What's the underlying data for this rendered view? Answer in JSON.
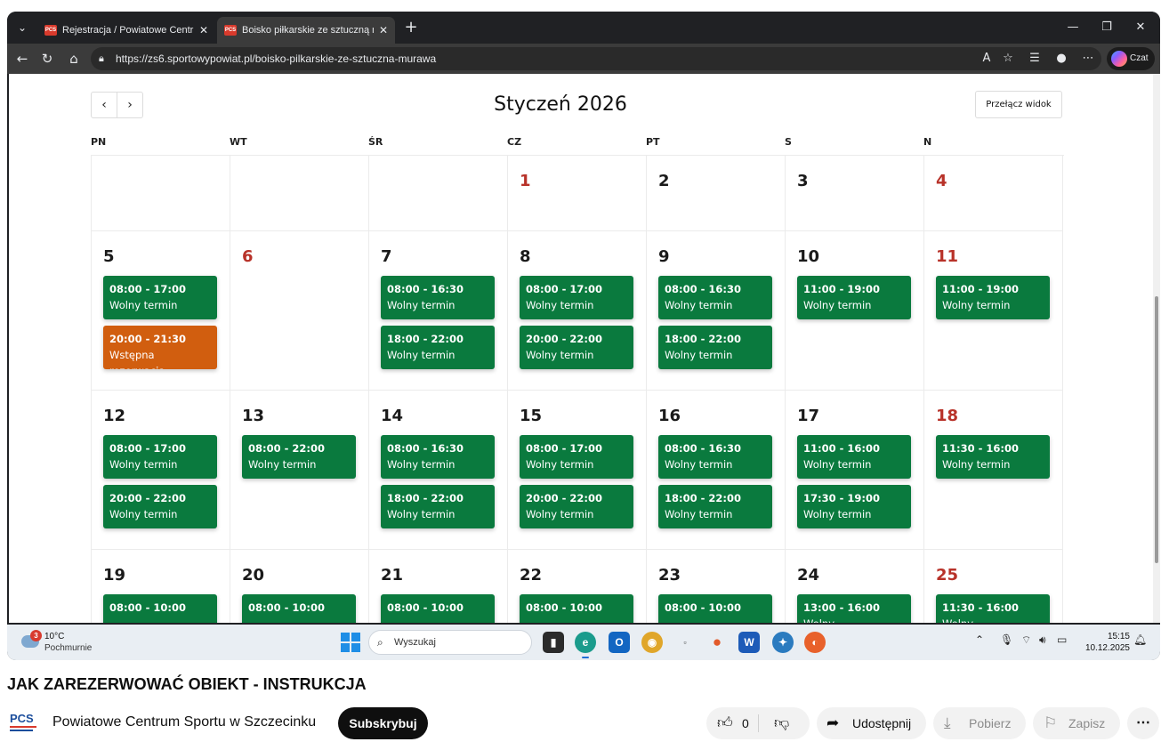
{
  "browser": {
    "tabs": [
      {
        "favicon": "PCS",
        "title": "Rejestracja / Powiatowe Centrum S"
      },
      {
        "favicon": "PCS",
        "title": "Boisko piłkarskie ze sztuczną mura"
      }
    ],
    "url": "https://zs6.sportowypowiat.pl/boisko-pilkarskie-ze-sztuczna-murawa",
    "copilot_label": "Czat"
  },
  "calendar": {
    "title": "Styczeń 2026",
    "prev_label": "‹",
    "next_label": "›",
    "view_toggle_label": "Przełącz widok",
    "weekdays": [
      "PN",
      "WT",
      "ŚR",
      "CZ",
      "PT",
      "S",
      "N"
    ],
    "weeks": [
      [
        {
          "day": "",
          "events": []
        },
        {
          "day": "",
          "events": []
        },
        {
          "day": "",
          "events": []
        },
        {
          "day": "1",
          "sunday": true,
          "events": []
        },
        {
          "day": "2",
          "events": []
        },
        {
          "day": "3",
          "events": []
        },
        {
          "day": "4",
          "sunday": true,
          "events": []
        }
      ],
      [
        {
          "day": "5",
          "events": [
            {
              "time": "08:00 - 17:00",
              "label": "Wolny termin"
            },
            {
              "time": "20:00 - 21:30",
              "label": "Wstępna rezerwacja",
              "status": "pending"
            }
          ]
        },
        {
          "day": "6",
          "sunday": true,
          "events": []
        },
        {
          "day": "7",
          "events": [
            {
              "time": "08:00 - 16:30",
              "label": "Wolny termin"
            },
            {
              "time": "18:00 - 22:00",
              "label": "Wolny termin"
            }
          ]
        },
        {
          "day": "8",
          "events": [
            {
              "time": "08:00 - 17:00",
              "label": "Wolny termin"
            },
            {
              "time": "20:00 - 22:00",
              "label": "Wolny termin"
            }
          ]
        },
        {
          "day": "9",
          "events": [
            {
              "time": "08:00 - 16:30",
              "label": "Wolny termin"
            },
            {
              "time": "18:00 - 22:00",
              "label": "Wolny termin"
            }
          ]
        },
        {
          "day": "10",
          "events": [
            {
              "time": "11:00 - 19:00",
              "label": "Wolny termin"
            }
          ]
        },
        {
          "day": "11",
          "sunday": true,
          "events": [
            {
              "time": "11:00 - 19:00",
              "label": "Wolny termin"
            }
          ]
        }
      ],
      [
        {
          "day": "12",
          "events": [
            {
              "time": "08:00 - 17:00",
              "label": "Wolny termin"
            },
            {
              "time": "20:00 - 22:00",
              "label": "Wolny termin"
            }
          ]
        },
        {
          "day": "13",
          "events": [
            {
              "time": "08:00 - 22:00",
              "label": "Wolny termin"
            }
          ]
        },
        {
          "day": "14",
          "events": [
            {
              "time": "08:00 - 16:30",
              "label": "Wolny termin"
            },
            {
              "time": "18:00 - 22:00",
              "label": "Wolny termin"
            }
          ]
        },
        {
          "day": "15",
          "events": [
            {
              "time": "08:00 - 17:00",
              "label": "Wolny termin"
            },
            {
              "time": "20:00 - 22:00",
              "label": "Wolny termin"
            }
          ]
        },
        {
          "day": "16",
          "events": [
            {
              "time": "08:00 - 16:30",
              "label": "Wolny termin"
            },
            {
              "time": "18:00 - 22:00",
              "label": "Wolny termin"
            }
          ]
        },
        {
          "day": "17",
          "events": [
            {
              "time": "11:00 - 16:00",
              "label": "Wolny termin"
            },
            {
              "time": "17:30 - 19:00",
              "label": "Wolny termin"
            }
          ]
        },
        {
          "day": "18",
          "sunday": true,
          "events": [
            {
              "time": "11:30 - 16:00",
              "label": "Wolny termin"
            }
          ]
        }
      ],
      [
        {
          "day": "19",
          "events": [
            {
              "time": "08:00 - 10:00",
              "label": ""
            }
          ]
        },
        {
          "day": "20",
          "events": [
            {
              "time": "08:00 - 10:00",
              "label": ""
            }
          ]
        },
        {
          "day": "21",
          "events": [
            {
              "time": "08:00 - 10:00",
              "label": ""
            }
          ]
        },
        {
          "day": "22",
          "events": [
            {
              "time": "08:00 - 10:00",
              "label": ""
            }
          ]
        },
        {
          "day": "23",
          "events": [
            {
              "time": "08:00 - 10:00",
              "label": ""
            }
          ]
        },
        {
          "day": "24",
          "events": [
            {
              "time": "13:00 - 16:00",
              "label": "Wolny"
            }
          ]
        },
        {
          "day": "25",
          "sunday": true,
          "events": [
            {
              "time": "11:30 - 16:00",
              "label": "Wolny"
            }
          ]
        }
      ]
    ]
  },
  "taskbar": {
    "weather_badge": "3",
    "temperature": "10°C",
    "weather_desc": "Pochmurnie",
    "search_placeholder": "Wyszukaj",
    "time": "15:15",
    "date": "10.12.2025"
  },
  "video": {
    "title": "JAK ZAREZERWOWAĆ OBIEKT - INSTRUKCJA",
    "channel_logo_text": "PCS",
    "channel_name": "Powiatowe Centrum Sportu w Szczecinku",
    "subscribe_label": "Subskrybuj",
    "like_count": "0",
    "share_label": "Udostępnij",
    "download_label": "Pobierz",
    "save_label": "Zapisz"
  },
  "colors": {
    "free_slot": "#0a7a3e",
    "pending_slot": "#d15e0f",
    "sunday_text": "#b83229"
  }
}
